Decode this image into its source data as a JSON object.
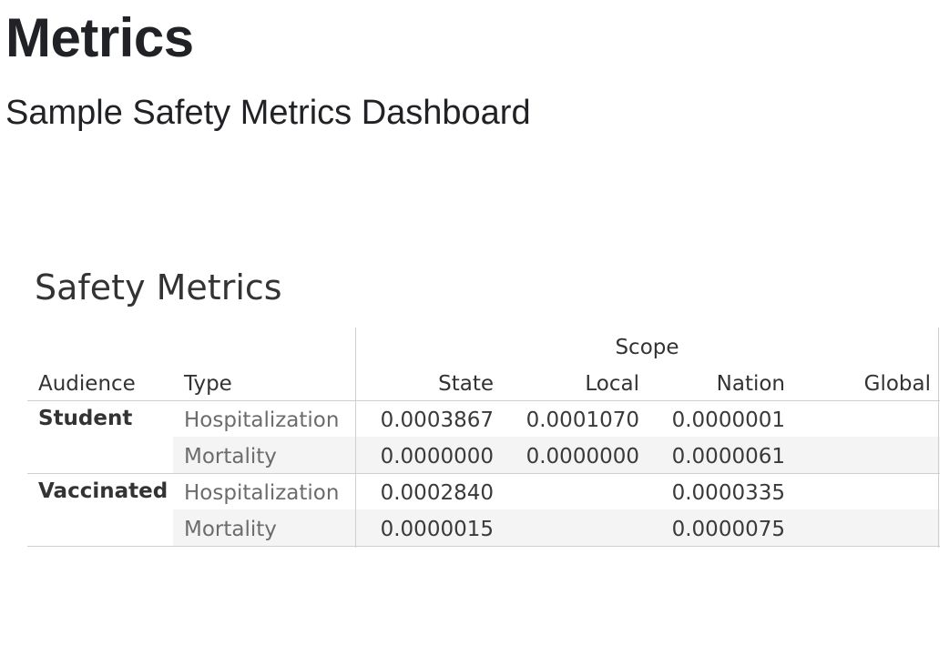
{
  "page": {
    "title": "Metrics",
    "subtitle": "Sample Safety Metrics Dashboard"
  },
  "sheet": {
    "title": "Safety Metrics"
  },
  "table": {
    "scope_header": "Scope",
    "headers": {
      "audience": "Audience",
      "type": "Type",
      "state": "State",
      "local": "Local",
      "nation": "Nation",
      "global": "Global"
    },
    "groups": [
      {
        "audience": "Student",
        "rows": [
          {
            "type": "Hospitalization",
            "state": "0.0003867",
            "local": "0.0001070",
            "nation": "0.0000001",
            "global": ""
          },
          {
            "type": "Mortality",
            "state": "0.0000000",
            "local": "0.0000000",
            "nation": "0.0000061",
            "global": ""
          }
        ]
      },
      {
        "audience": "Vaccinated",
        "rows": [
          {
            "type": "Hospitalization",
            "state": "0.0002840",
            "local": "",
            "nation": "0.0000335",
            "global": ""
          },
          {
            "type": "Mortality",
            "state": "0.0000015",
            "local": "",
            "nation": "0.0000075",
            "global": ""
          }
        ]
      }
    ]
  },
  "colors": {
    "band": "#f4f4f4",
    "rule": "#cfcfcf",
    "title_text": "#202226",
    "type_text": "#6c6c6c"
  }
}
